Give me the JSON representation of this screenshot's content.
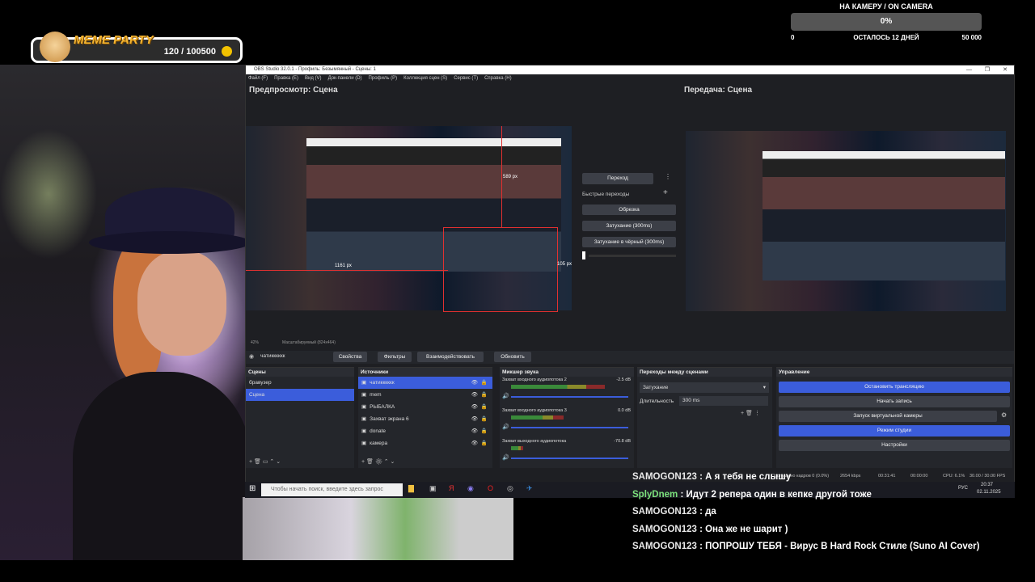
{
  "goal": {
    "title": "НА КАМЕРУ / ON CAMERA",
    "percent": "0%",
    "min": "0",
    "remaining": "ОСТАЛОСЬ 12 ДНЕЙ",
    "max": "50 000",
    "progress": 0
  },
  "meme": {
    "title": "MEME PARTY",
    "count": "120 / 100500"
  },
  "obs": {
    "title": "OBS Studio 32.0.1 - Профиль: Безымянный - Сцены: 1",
    "menu": [
      "Файл (F)",
      "Правка (E)",
      "Вид (V)",
      "Док-панели (D)",
      "Профиль (P)",
      "Коллекция сцен (S)",
      "Сервис (T)",
      "Справка (H)"
    ],
    "preview_label": "Предпросмотр: Сцена",
    "program_label": "Передача: Сцена",
    "transition_btn": "Переход",
    "quick_transitions": "Быстрые переходы",
    "transitions": [
      "Обрезка",
      "Затухание (300ms)",
      "Затухание в чёрный (300ms)"
    ],
    "dim1": "1161 px",
    "dim2": "589 px",
    "dim3": "105 px",
    "zoom": "42%",
    "scale_mode": "Масштабируемый (824x464)",
    "source_toolbar": {
      "selected": "чатикккккк",
      "props": "Свойства",
      "filters": "Фильтры",
      "interact": "Взаимодействовать",
      "refresh": "Обновить"
    },
    "scenes": {
      "header": "Сцены",
      "items": [
        "бравузер",
        "Сцена"
      ],
      "selected": 1
    },
    "sources": {
      "header": "Источники",
      "items": [
        "чатикккккк",
        "mem",
        "РЫБАЛКА",
        "Захват экрана 6",
        "donate",
        "камера"
      ]
    },
    "mixer": {
      "header": "Микшер звука",
      "channels": [
        {
          "name": "Захват входного аудиопотока 2",
          "db": "-2.5 dB",
          "level": 0.8
        },
        {
          "name": "Захват входного аудиопотока 3",
          "db": "0.0 dB",
          "level": 0.45
        },
        {
          "name": "Захват выходного аудиопотока",
          "db": "-70.8 dB",
          "level": 0.1
        }
      ],
      "ticks": [
        "-60",
        "-55",
        "-50",
        "-45",
        "-40",
        "-35",
        "-30",
        "-25",
        "-20",
        "-15",
        "-10",
        "-5",
        "0"
      ]
    },
    "scene_transitions": {
      "header": "Переходы между сценами",
      "type": "Затухание",
      "duration_label": "Длительность",
      "duration": "300 ms"
    },
    "controls": {
      "header": "Управление",
      "stop_stream": "Остановить трансляцию",
      "start_record": "Начать запись",
      "virtual_cam": "Запуск виртуальной камеры",
      "studio_mode": "Режим студии",
      "settings": "Настройки"
    },
    "status": {
      "dropped": "Пропущено кадров 0 (0.0%)",
      "bitrate": "2654 kbps",
      "time": "00:31:41",
      "rec_time": "00:00:00",
      "cpu": "CPU: 6.1%",
      "fps": "30.00 / 30.00 FPS"
    }
  },
  "taskbar": {
    "search_placeholder": "Чтобы начать поиск, введите здесь запрос",
    "time": "20:37",
    "date": "02.11.2025",
    "lang": "РУС"
  },
  "chat": [
    {
      "user": "SAMOGON123",
      "text": " : А я тебя не слышу"
    },
    {
      "user": "SplyDnem",
      "text": " : Идут 2 репера один в кепке другой тоже"
    },
    {
      "user": "SAMOGON123",
      "text": " : да"
    },
    {
      "user": "SAMOGON123",
      "text": " : Она же не шарит )"
    },
    {
      "user": "SAMOGON123",
      "text": " : ПОПРОШУ ТЕБЯ - Вирус В Hard Rock Стиле (Suno AI Cover)"
    }
  ]
}
